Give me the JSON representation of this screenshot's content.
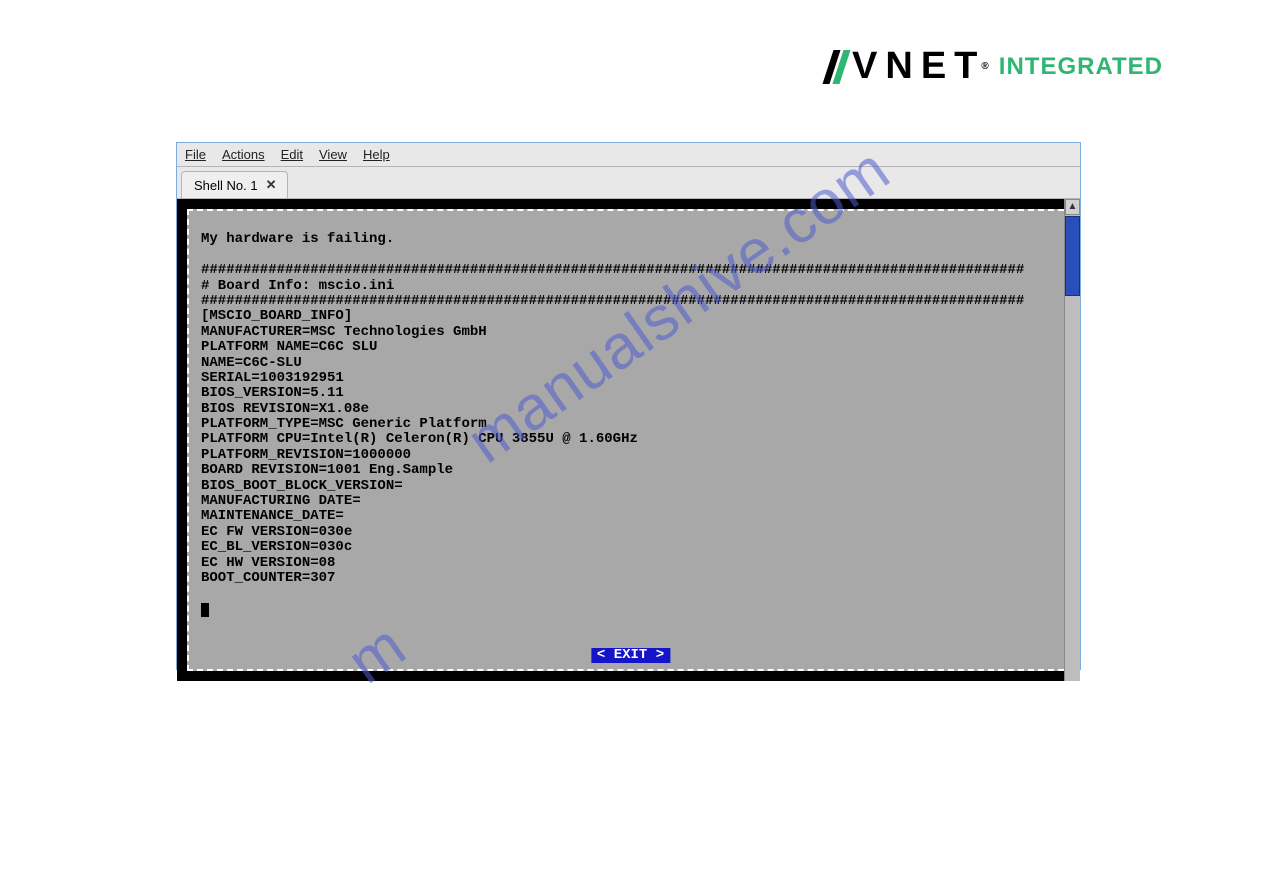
{
  "logo": {
    "brand": "VNET",
    "suffix": "INTEGRATED",
    "reg": "®"
  },
  "menubar": {
    "file": "File",
    "actions": "Actions",
    "edit": "Edit",
    "view": "View",
    "help": "Help"
  },
  "tab": {
    "label": "Shell No. 1",
    "close": "✕"
  },
  "terminal": {
    "title_line": "My hardware is failing.",
    "rule": "##################################################################################################",
    "comment": "# Board Info: mscio.ini",
    "section": "[MSCIO_BOARD_INFO]",
    "rows": {
      "manufacturer": "MANUFACTURER=MSC Technologies GmbH",
      "platform_name": "PLATFORM NAME=C6C SLU",
      "name": "NAME=C6C-SLU",
      "serial": "SERIAL=1003192951",
      "bios_version": "BIOS_VERSION=5.11",
      "bios_revision": "BIOS REVISION=X1.08e",
      "platform_type": "PLATFORM_TYPE=MSC Generic Platform",
      "platform_cpu": "PLATFORM CPU=Intel(R) Celeron(R) CPU 3855U @ 1.60GHz",
      "platform_revision": "PLATFORM_REVISION=1000000",
      "board_revision": "BOARD REVISION=1001 Eng.Sample",
      "bios_boot_block": "BIOS_BOOT_BLOCK_VERSION=",
      "manufacturing_date": "MANUFACTURING DATE=",
      "maintenance_date": "MAINTENANCE_DATE=",
      "ec_fw": "EC FW VERSION=030e",
      "ec_bl": "EC_BL_VERSION=030c",
      "ec_hw": "EC HW VERSION=08",
      "boot_counter": "BOOT_COUNTER=307"
    },
    "exit": "< EXIT >"
  },
  "watermark": "manualshive.com"
}
